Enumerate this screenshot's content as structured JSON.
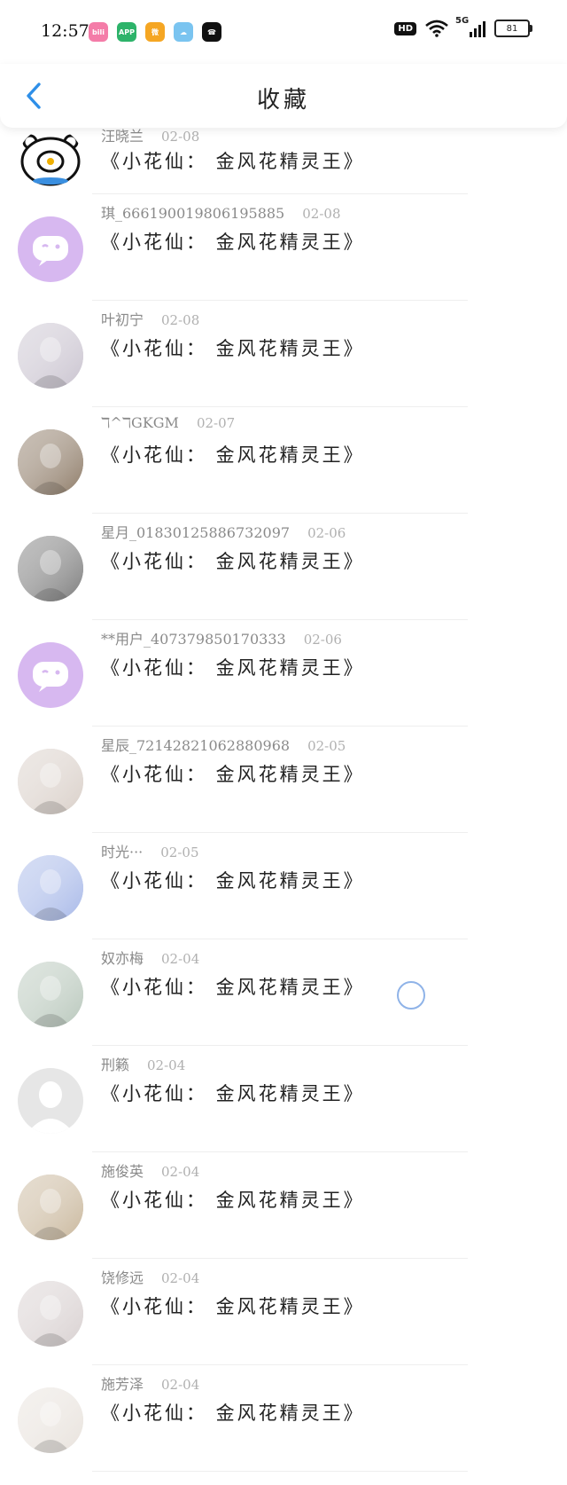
{
  "status_bar": {
    "time": "12:57",
    "battery": "81",
    "network": "5G",
    "hd_label": "HD",
    "app_icons": [
      {
        "icon": "bilibili-icon",
        "color": "#f47ca8",
        "label": "bili"
      },
      {
        "icon": "app-store-icon",
        "color": "#2db36a",
        "label": "APP"
      },
      {
        "icon": "weibo-icon",
        "color": "#f5a623",
        "label": "微"
      },
      {
        "icon": "weather-icon",
        "color": "#7ac4f0",
        "label": "☁"
      },
      {
        "icon": "phone-app-icon",
        "color": "#111111",
        "label": "☎"
      }
    ]
  },
  "header": {
    "title": "收藏",
    "accent_color": "#2e8fe8"
  },
  "items": [
    {
      "name": "汪晓兰",
      "date": "02-08",
      "title": "《小花仙： 金风花精灵王》",
      "avatar": "bear-cartoon",
      "avatar_color": "#ffffff"
    },
    {
      "name": "琪_666190019806195885",
      "date": "02-08",
      "title": "《小花仙： 金风花精灵王》",
      "avatar": "default-chat",
      "avatar_color": "#d7b8f0"
    },
    {
      "name": "叶初宁",
      "date": "02-08",
      "title": "《小花仙： 金风花精灵王》",
      "avatar": "anime-girl",
      "avatar_color": "#c9c3cf"
    },
    {
      "name": "ℸ^ℸGKGM",
      "date": "02-07",
      "title": "《小花仙： 金风花精灵王》",
      "avatar": "photo-lantern",
      "avatar_color": "#8d7a66"
    },
    {
      "name": "星月_01830125886732097",
      "date": "02-06",
      "title": "《小花仙： 金风花精灵王》",
      "avatar": "photo-girl-gray",
      "avatar_color": "#7c7c7c"
    },
    {
      "name": "**用户_407379850170333",
      "date": "02-06",
      "title": "《小花仙： 金风花精灵王》",
      "avatar": "default-chat",
      "avatar_color": "#d7b8f0"
    },
    {
      "name": "星辰_72142821062880968",
      "date": "02-05",
      "title": "《小花仙： 金风花精灵王》",
      "avatar": "anime-portrait",
      "avatar_color": "#d9cfc8"
    },
    {
      "name": "时光···",
      "date": "02-05",
      "title": "《小花仙： 金风花精灵王》",
      "avatar": "anime-blue",
      "avatar_color": "#a7b8e8"
    },
    {
      "name": "奴亦梅",
      "date": "02-04",
      "title": "《小花仙： 金风花精灵王》",
      "avatar": "photo-window",
      "avatar_color": "#b8c7bb"
    },
    {
      "name": "刑籁",
      "date": "02-04",
      "title": "《小花仙： 金风花精灵王》",
      "avatar": "default-person",
      "avatar_color": "#e6e6e6"
    },
    {
      "name": "施俊英",
      "date": "02-04",
      "title": "《小花仙： 金风花精灵王》",
      "avatar": "photo-shell",
      "avatar_color": "#c9b79c"
    },
    {
      "name": "饶修远",
      "date": "02-04",
      "title": "《小花仙： 金风花精灵王》",
      "avatar": "photo-selfie",
      "avatar_color": "#d8d0d0"
    },
    {
      "name": "施芳泽",
      "date": "02-04",
      "title": "《小花仙： 金风花精灵王》",
      "avatar": "photo-cat",
      "avatar_color": "#e8e2dc"
    }
  ]
}
